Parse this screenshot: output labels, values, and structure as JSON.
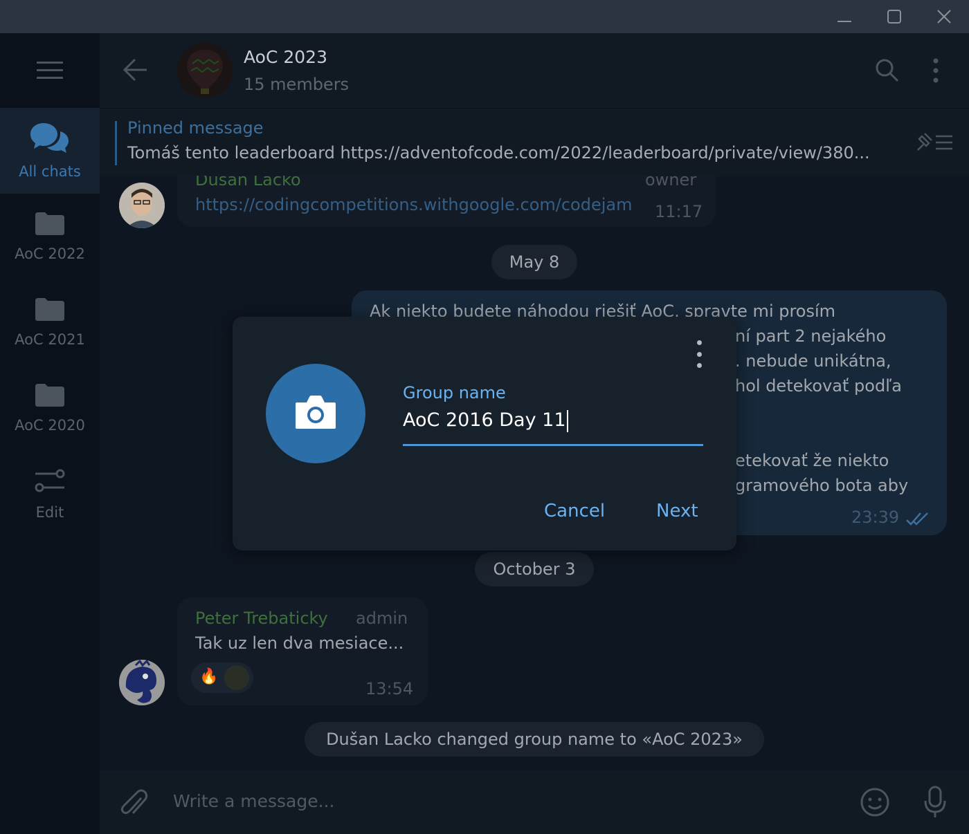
{
  "window": {
    "minimize_icon": "minimize-icon",
    "maximize_icon": "maximize-icon",
    "close_icon": "close-icon"
  },
  "sidebar": {
    "folders": [
      {
        "label": "All chats",
        "icon": "chats-icon",
        "active": true
      },
      {
        "label": "AoC 2022",
        "icon": "folder-icon"
      },
      {
        "label": "AoC 2021",
        "icon": "folder-icon"
      },
      {
        "label": "AoC 2020",
        "icon": "folder-icon"
      },
      {
        "label": "Edit",
        "icon": "sliders-icon"
      }
    ]
  },
  "header": {
    "title": "AoC 2023",
    "subtitle": "15 members"
  },
  "pinned": {
    "title": "Pinned message",
    "text": "Tomáš tento leaderboard https://adventofcode.com/2022/leaderboard/private/view/380..."
  },
  "messages": {
    "first": {
      "name": "Dusan Lacko",
      "role": "owner",
      "text": "https://codingcompetitions.withgoogle.com/codejam",
      "time": "11:17"
    },
    "date1": "May 8",
    "outgoing": {
      "lines": [
        "Ak niekto budete náhodou riešiť AoC, spravte mi prosím",
        "ní part 2 nejakého",
        ". nebude unikátna,",
        "hol detekovať podľa",
        "etekovať že niekto",
        "gramového bota aby"
      ],
      "time": "23:39"
    },
    "date2": "October 3",
    "second": {
      "name": "Peter Trebaticky",
      "role": "admin",
      "text": "Tak uz len dva mesiace...",
      "time": "13:54",
      "reaction": "🔥"
    },
    "service": "Dušan Lacko changed group name to «AoC 2023»"
  },
  "composer": {
    "placeholder": "Write a message..."
  },
  "dialog": {
    "field_label": "Group name",
    "field_value": "AoC 2016 Day 11",
    "cancel": "Cancel",
    "next": "Next"
  },
  "colors": {
    "accent": "#6ab2f2",
    "camera_circle": "#2b6ea8",
    "dialog_bg": "#17212b"
  }
}
